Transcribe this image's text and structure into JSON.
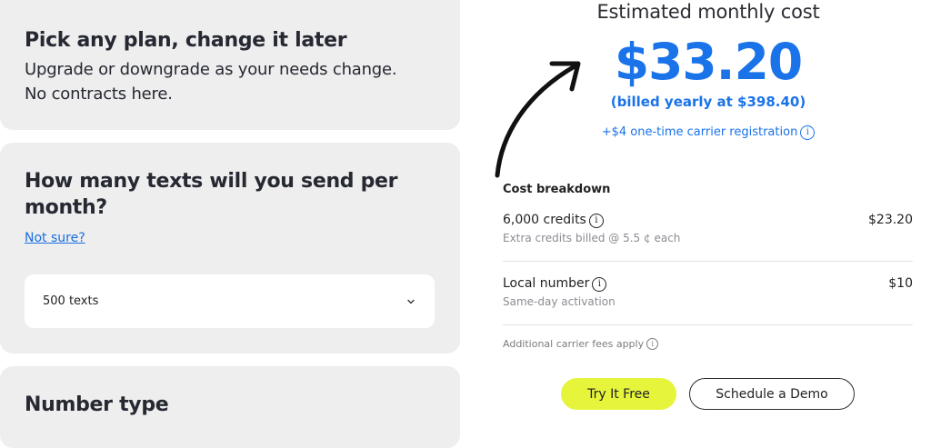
{
  "plan_card": {
    "title": "Pick any plan, change it later",
    "description_line1": "Upgrade or downgrade as your needs change.",
    "description_line2": "No contracts here."
  },
  "texts_card": {
    "title_line1": "How many texts will you send per",
    "title_line2": "month?",
    "help_link": "Not sure?",
    "select_value": "500 texts"
  },
  "number_card": {
    "title": "Number type"
  },
  "estimate": {
    "title": "Estimated monthly cost",
    "price": "$33.20",
    "billed": "(billed yearly at $398.40)",
    "carrier_registration": "+$4 one-time carrier registration"
  },
  "breakdown": {
    "title": "Cost breakdown",
    "items": [
      {
        "label": "6,000 credits",
        "sub": "Extra credits billed @ 5.5 ¢ each",
        "price": "$23.20"
      },
      {
        "label": "Local number",
        "sub": "Same-day activation",
        "price": "$10"
      }
    ],
    "fees_note": "Additional carrier fees apply"
  },
  "actions": {
    "try_label": "Try It Free",
    "demo_label": "Schedule a Demo"
  },
  "colors": {
    "accent_blue": "#1a73e8",
    "cta_yellow": "#e6f53c",
    "card_gray": "#eeeeee"
  },
  "icons": {
    "info": "info-icon",
    "chevron": "chevron-down-icon",
    "arrow": "curved-arrow-icon"
  }
}
